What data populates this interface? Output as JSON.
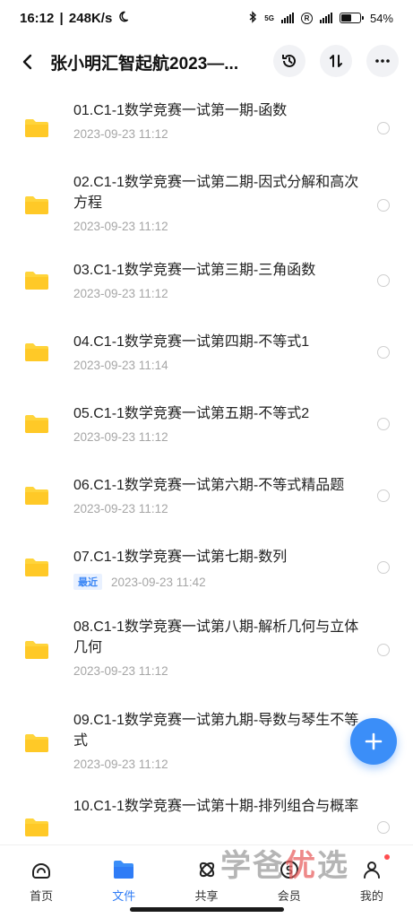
{
  "status_bar": {
    "time": "16:12",
    "speed": "248K/s",
    "network": "5G",
    "battery": "54%",
    "battery_level": 0.54
  },
  "header": {
    "title": "张小明汇智起航2023—..."
  },
  "files": [
    {
      "name": "01.C1-1数学竞赛一试第一期-函数",
      "date": "2023-09-23  11:12",
      "tag": ""
    },
    {
      "name": "02.C1-1数学竞赛一试第二期-因式分解和高次方程",
      "date": "2023-09-23  11:12",
      "tag": ""
    },
    {
      "name": "03.C1-1数学竞赛一试第三期-三角函数",
      "date": "2023-09-23  11:12",
      "tag": ""
    },
    {
      "name": "04.C1-1数学竞赛一试第四期-不等式1",
      "date": "2023-09-23  11:14",
      "tag": ""
    },
    {
      "name": "05.C1-1数学竞赛一试第五期-不等式2",
      "date": "2023-09-23  11:12",
      "tag": ""
    },
    {
      "name": "06.C1-1数学竞赛一试第六期-不等式精品题",
      "date": "2023-09-23  11:12",
      "tag": ""
    },
    {
      "name": "07.C1-1数学竞赛一试第七期-数列",
      "date": "2023-09-23  11:42",
      "tag": "最近"
    },
    {
      "name": "08.C1-1数学竞赛一试第八期-解析几何与立体几何",
      "date": "2023-09-23  11:12",
      "tag": ""
    },
    {
      "name": "09.C1-1数学竞赛一试第九期-导数与琴生不等式",
      "date": "2023-09-23  11:12",
      "tag": ""
    },
    {
      "name": "10.C1-1数学竞赛一试第十期-排列组合与概率",
      "date": "",
      "tag": ""
    }
  ],
  "nav": {
    "items": [
      {
        "label": "首页"
      },
      {
        "label": "文件"
      },
      {
        "label": "共享"
      },
      {
        "label": "会员"
      },
      {
        "label": "我的"
      }
    ]
  },
  "watermark": {
    "part1": "学爸",
    "part2": "优",
    "part3": "选"
  },
  "colors": {
    "accent": "#3b8ef8",
    "folder": "#ffd43b",
    "date": "#a6a6a6"
  }
}
